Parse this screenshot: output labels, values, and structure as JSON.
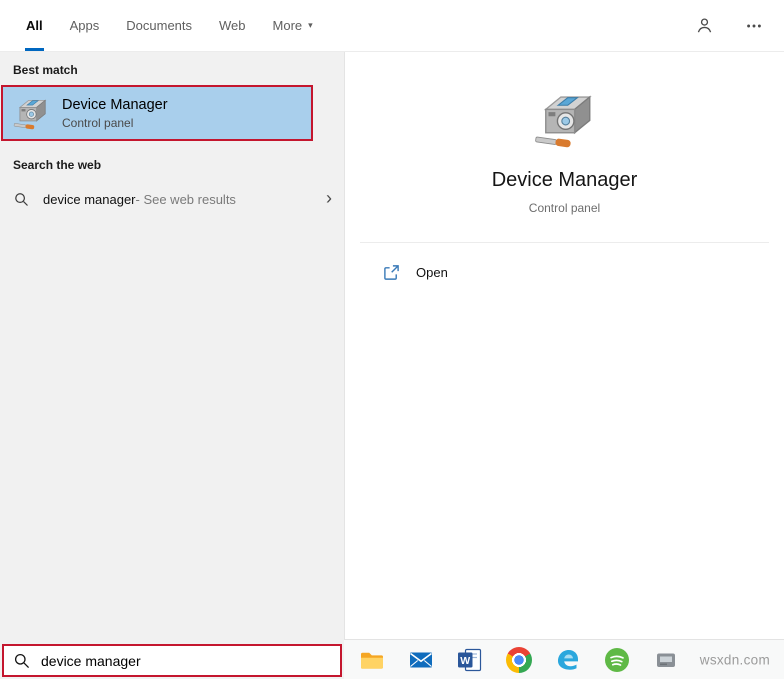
{
  "colors": {
    "accent_blue": "#0067c0",
    "highlight_blue": "#a9cfec",
    "annotation_red": "#c4162e"
  },
  "icons": {
    "more_caret": "▾",
    "chevron_right": "›"
  },
  "tabs": {
    "items": [
      {
        "label": "All"
      },
      {
        "label": "Apps"
      },
      {
        "label": "Documents"
      },
      {
        "label": "Web"
      },
      {
        "label": "More"
      }
    ]
  },
  "left_panel": {
    "best_match_header": "Best match",
    "best_match": {
      "title": "Device Manager",
      "subtitle": "Control panel"
    },
    "search_web_header": "Search the web",
    "web_suggestion": {
      "query": "device manager",
      "hint": " - See web results"
    },
    "search_input": {
      "value": "device manager"
    }
  },
  "preview_panel": {
    "title": "Device Manager",
    "subtitle": "Control panel",
    "open_label": "Open"
  },
  "taskbar": {
    "watermark": "wsxdn.com"
  }
}
